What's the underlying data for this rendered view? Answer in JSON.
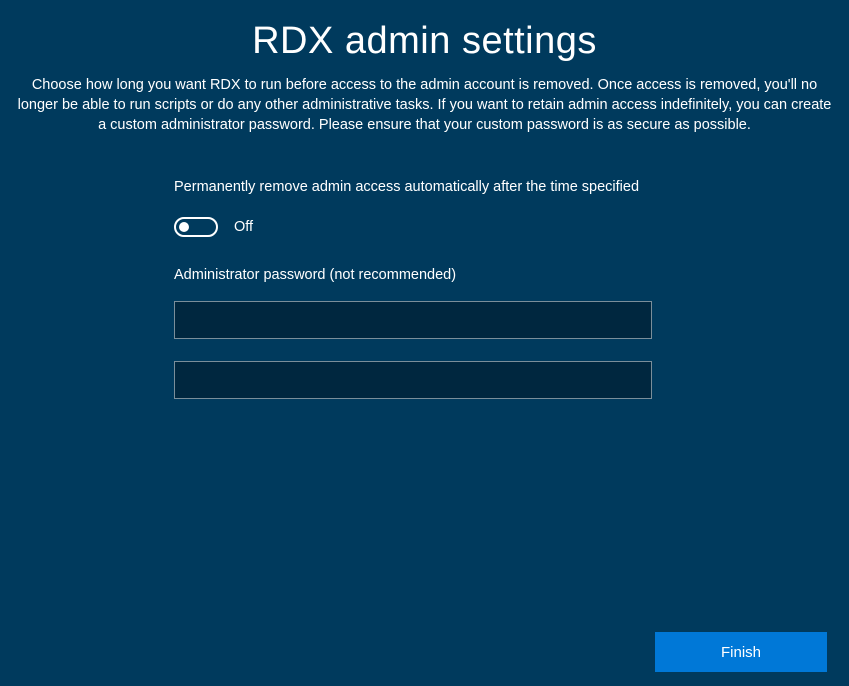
{
  "title": "RDX admin settings",
  "description": "Choose how long you want RDX to run before access to the admin account is removed. Once access is removed, you'll no longer be able to run scripts or do any other administrative tasks. If you want to retain admin access indefinitely, you can create a custom administrator password. Please ensure that your custom password is as secure as possible.",
  "form": {
    "autoRemoveLabel": "Permanently remove admin access automatically after the time specified",
    "toggleState": "Off",
    "passwordLabel": "Administrator password (not recommended)",
    "password1": "",
    "password2": ""
  },
  "buttons": {
    "finish": "Finish"
  }
}
